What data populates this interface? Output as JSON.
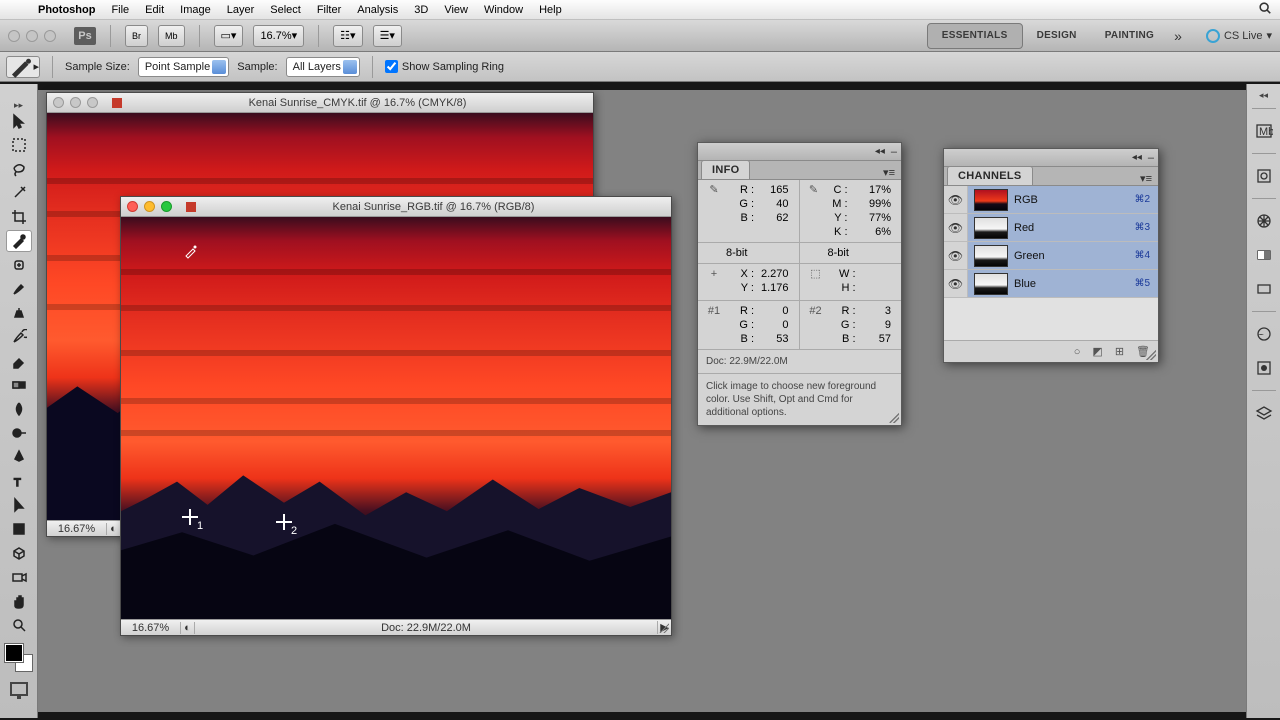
{
  "menubar": {
    "app": "Photoshop",
    "items": [
      "File",
      "Edit",
      "Image",
      "Layer",
      "Select",
      "Filter",
      "Analysis",
      "3D",
      "View",
      "Window",
      "Help"
    ]
  },
  "appbar": {
    "zoom": "16.7%",
    "workspaces": [
      "ESSENTIALS",
      "DESIGN",
      "PAINTING"
    ],
    "active_ws": "ESSENTIALS",
    "cslive": "CS Live"
  },
  "optbar": {
    "sample_size_label": "Sample Size:",
    "sample_size_value": "Point Sample",
    "sample_label": "Sample:",
    "sample_value": "All Layers",
    "show_ring": "Show Sampling Ring"
  },
  "doc_back": {
    "title": "Kenai Sunrise_CMYK.tif @ 16.7% (CMYK/8)",
    "zoom": "16.67%"
  },
  "doc_front": {
    "title": "Kenai Sunrise_RGB.tif @ 16.7% (RGB/8)",
    "zoom": "16.67%",
    "doc_size": "Doc: 22.9M/22.0M"
  },
  "info": {
    "title": "INFO",
    "rgb": {
      "R": "165",
      "G": "40",
      "B": "62"
    },
    "cmyk": {
      "C": "17%",
      "M": "99%",
      "Y": "77%",
      "K": "6%"
    },
    "bit1": "8-bit",
    "bit2": "8-bit",
    "xy": {
      "X": "2.270",
      "Y": "1.176"
    },
    "wh": {
      "W": "",
      "H": ""
    },
    "s1": {
      "label": "#1",
      "R": "0",
      "G": "0",
      "B": "53"
    },
    "s2": {
      "label": "#2",
      "R": "3",
      "G": "9",
      "B": "57"
    },
    "doc": "Doc: 22.9M/22.0M",
    "hint": "Click image to choose new foreground color. Use Shift, Opt and Cmd for additional options."
  },
  "channels": {
    "title": "CHANNELS",
    "rows": [
      {
        "name": "RGB",
        "shortcut": "⌘2",
        "type": "rgb"
      },
      {
        "name": "Red",
        "shortcut": "⌘3",
        "type": "ch"
      },
      {
        "name": "Green",
        "shortcut": "⌘4",
        "type": "ch"
      },
      {
        "name": "Blue",
        "shortcut": "⌘5",
        "type": "ch"
      }
    ]
  }
}
